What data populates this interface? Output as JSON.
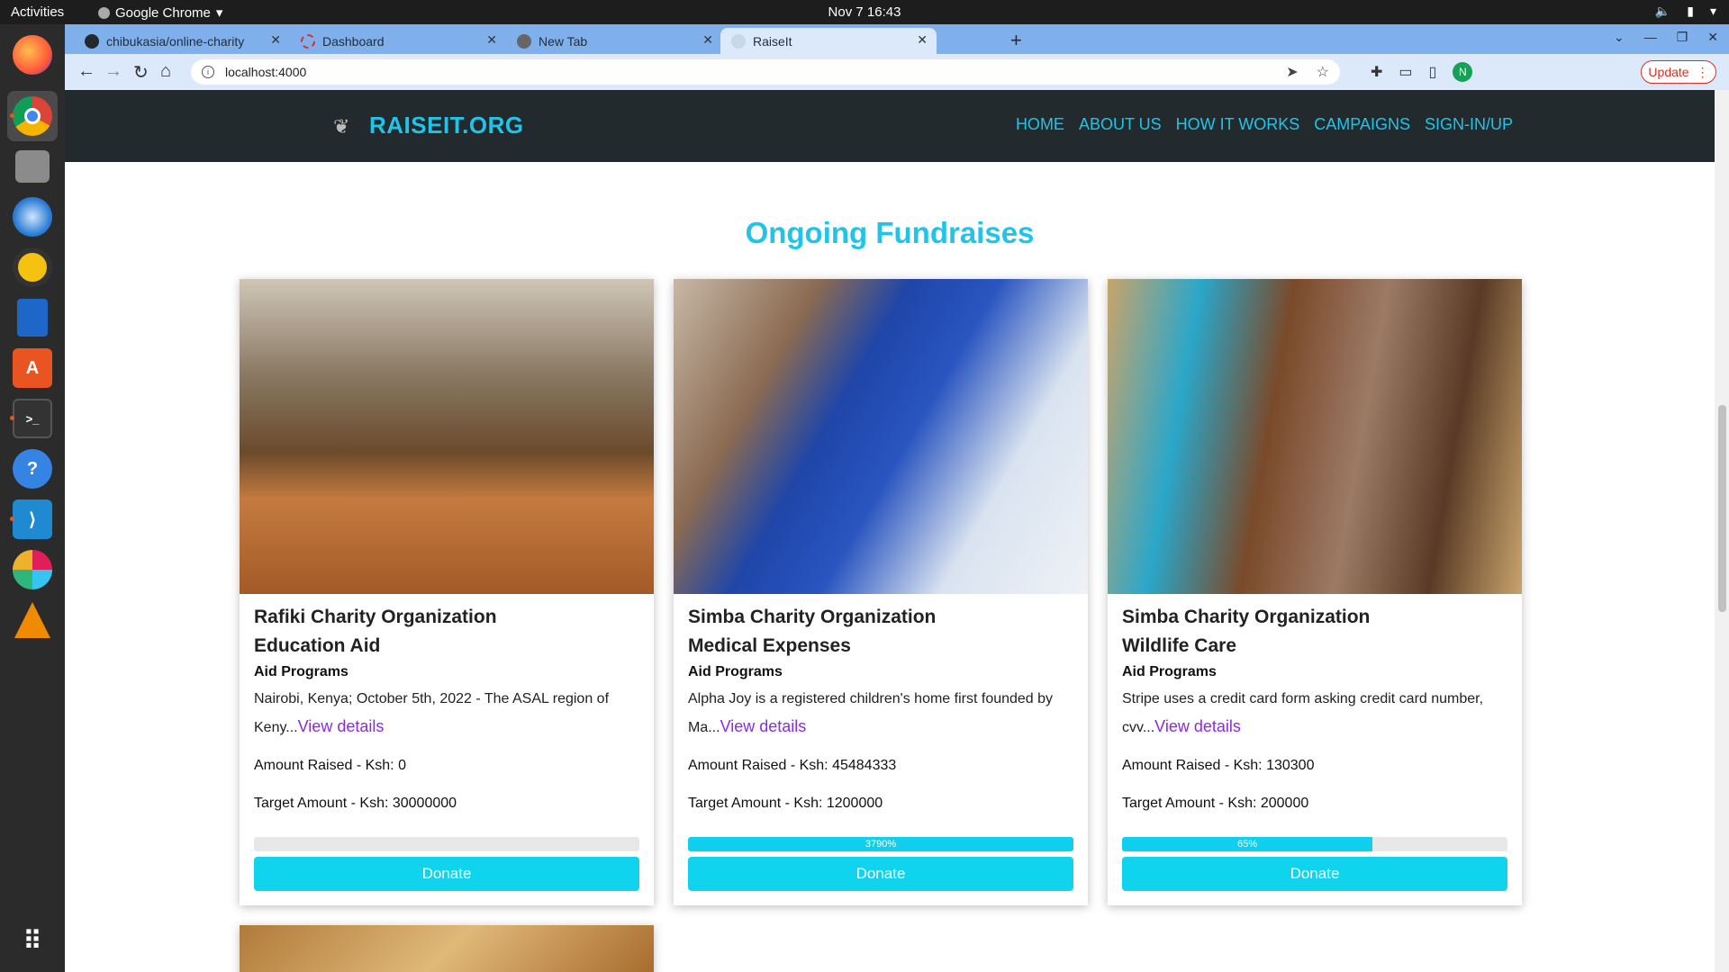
{
  "os": {
    "activities": "Activities",
    "app_name": "Google Chrome",
    "clock": "Nov 7  16:43"
  },
  "browser": {
    "tabs": [
      {
        "label": "chibukasia/online-charity",
        "active": false
      },
      {
        "label": "Dashboard",
        "active": false
      },
      {
        "label": "New Tab",
        "active": false
      },
      {
        "label": "RaiseIt",
        "active": true
      }
    ],
    "url": "localhost:4000",
    "update_label": "Update",
    "profile_initial": "N"
  },
  "site": {
    "brand": "RAISEIT.ORG",
    "nav": [
      "HOME",
      "ABOUT US",
      "HOW IT WORKS",
      "CAMPAIGNS",
      "SIGN-IN/UP"
    ],
    "heading": "Ongoing Fundraises"
  },
  "campaigns": [
    {
      "org": "Rafiki Charity Organization",
      "title": "Education Aid",
      "category": "Aid Programs",
      "description": "Nairobi, Kenya; October 5th, 2022 - The ASAL region of Keny...",
      "view_details": "View details",
      "amount_raised": "Amount Raised - Ksh: 0",
      "target_amount": "Target Amount - Ksh: 30000000",
      "progress_percent": 0,
      "progress_label": "",
      "donate_label": "Donate"
    },
    {
      "org": "Simba Charity Organization",
      "title": "Medical Expenses",
      "category": "Aid Programs",
      "description": "Alpha Joy is a registered children's home first founded by Ma...",
      "view_details": "View details",
      "amount_raised": "Amount Raised - Ksh: 45484333",
      "target_amount": "Target Amount - Ksh: 1200000",
      "progress_percent": 100,
      "progress_label": "3790%",
      "donate_label": "Donate"
    },
    {
      "org": "Simba Charity Organization",
      "title": "Wildlife Care",
      "category": "Aid Programs",
      "description": "Stripe uses a credit card form asking credit card number, cvv...",
      "view_details": "View details",
      "amount_raised": "Amount Raised - Ksh: 130300",
      "target_amount": "Target Amount - Ksh: 200000",
      "progress_percent": 65,
      "progress_label": "65%",
      "donate_label": "Donate"
    }
  ],
  "colors": {
    "accent": "#20c4e8",
    "nav_bg": "#222a2e",
    "link": "#8a2be2"
  }
}
